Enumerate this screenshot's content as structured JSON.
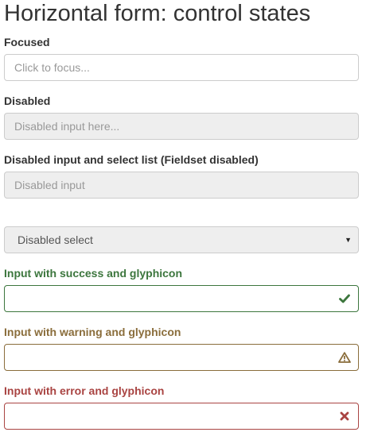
{
  "title": "Horizontal form: control states",
  "focused": {
    "label": "Focused",
    "placeholder": "Click to focus..."
  },
  "disabled": {
    "label": "Disabled",
    "placeholder": "Disabled input here..."
  },
  "fieldset": {
    "label": "Disabled input and select list (Fieldset disabled)",
    "input_placeholder": "Disabled input",
    "select_value": "Disabled select"
  },
  "success": {
    "label": "Input with success and glyphicon",
    "icon": "check-icon",
    "color": "#3c763d"
  },
  "warning": {
    "label": "Input with warning and glyphicon",
    "icon": "warning-sign-icon",
    "color": "#8a6d3b"
  },
  "error": {
    "label": "Input with error and glyphicon",
    "icon": "remove-icon",
    "color": "#a94442"
  }
}
